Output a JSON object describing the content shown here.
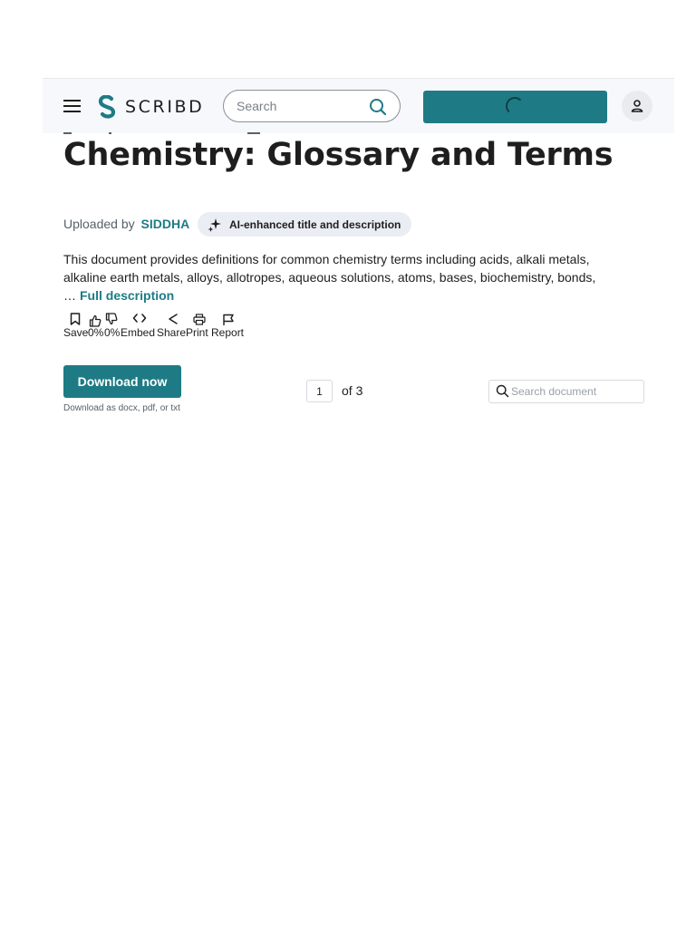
{
  "header": {
    "brand": "SCRIBD",
    "search_placeholder": "Search",
    "colors": {
      "brand": "#1e7b85",
      "header_bg": "#f7f8fb"
    }
  },
  "document": {
    "title": "Chemistry: Glossary and Terms",
    "uploaded_by_label": "Uploaded by",
    "uploader": "SIDDHA",
    "ai_badge": "AI-enhanced title and description",
    "description": "This document provides definitions for common chemistry terms including acids, alkali metals, alkaline earth metals, alloys, allotropes, aqueous solutions, atoms, bases, biochemistry, bonds,",
    "ellipsis": "…",
    "full_description_link": "Full description"
  },
  "actions": [
    {
      "icon": "bookmark-icon",
      "label": "Save"
    },
    {
      "icon": "thumbs-up-icon",
      "label": "0%"
    },
    {
      "icon": "thumbs-down-icon",
      "label": "0%"
    },
    {
      "icon": "embed-icon",
      "label": "Embed"
    },
    {
      "icon": "share-icon",
      "label": "Share"
    },
    {
      "icon": "print-icon",
      "label": "Print"
    },
    {
      "icon": "flag-icon",
      "label": "Report"
    }
  ],
  "download": {
    "button_label": "Download now",
    "note": "Download as docx, pdf, or txt"
  },
  "pager": {
    "current_page": "1",
    "total_label": "of 3"
  },
  "doc_search": {
    "placeholder": "Search document"
  }
}
